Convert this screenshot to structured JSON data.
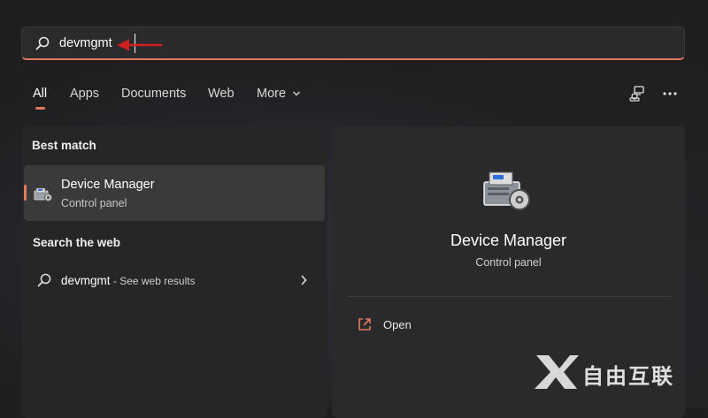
{
  "search": {
    "query": "devmgmt"
  },
  "tabs": [
    {
      "label": "All",
      "active": true
    },
    {
      "label": "Apps"
    },
    {
      "label": "Documents"
    },
    {
      "label": "Web"
    },
    {
      "label": "More"
    }
  ],
  "toolbar": {
    "icons": [
      "share-devices-icon",
      "more-options-icon"
    ]
  },
  "left": {
    "best_match_title": "Best match",
    "best_match": {
      "title": "Device Manager",
      "subtitle": "Control panel",
      "icon": "device-manager-icon"
    },
    "web_title": "Search the web",
    "web_result": {
      "query": "devmgmt",
      "hint": " - See web results"
    }
  },
  "right": {
    "title": "Device Manager",
    "subtitle": "Control panel",
    "actions": [
      {
        "label": "Open",
        "icon": "open-external-icon"
      }
    ]
  },
  "watermark": {
    "text": "自由互联"
  },
  "colors": {
    "accent": "#e07a5f",
    "annotation_arrow": "#d21f1f",
    "background": "#1f1f21"
  }
}
